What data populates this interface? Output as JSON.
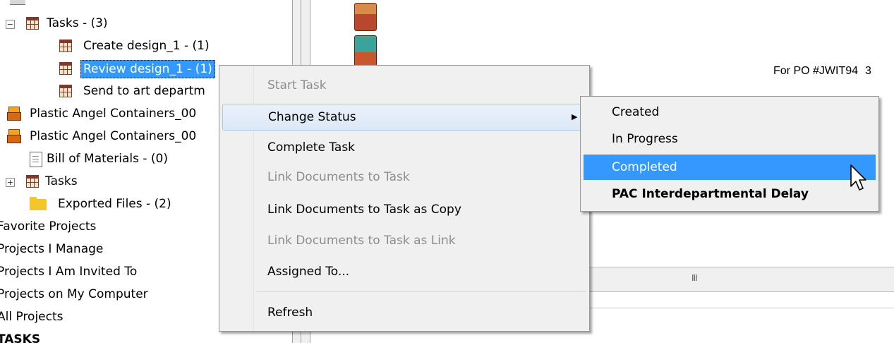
{
  "tree": {
    "items": [
      {
        "label": "Tasks - (3)"
      },
      {
        "label": "Create design_1 - (1)"
      },
      {
        "label": "Review design_1 - (1)"
      },
      {
        "label": "Send to art departm"
      },
      {
        "label": "Plastic Angel Containers_00"
      },
      {
        "label": "Plastic Angel Containers_00"
      },
      {
        "label": "Bill of Materials - (0)"
      },
      {
        "label": "Tasks"
      },
      {
        "label": "Exported Files - (2)"
      },
      {
        "label": "Favorite Projects"
      },
      {
        "label": "Projects I Manage"
      },
      {
        "label": "Projects I Am Invited To"
      },
      {
        "label": "Projects on My Computer"
      },
      {
        "label": "All Projects"
      },
      {
        "label": "TASKS"
      }
    ]
  },
  "right": {
    "po_label": "For PO #JWIT94",
    "po_count": "3",
    "scroll_grip": "III"
  },
  "context_menu": {
    "items": [
      {
        "label": "Start Task"
      },
      {
        "label": "Change Status"
      },
      {
        "label": "Complete Task"
      },
      {
        "label": "Link Documents to Task"
      },
      {
        "label": "Link Documents to Task as Copy"
      },
      {
        "label": "Link Documents to Task as Link"
      },
      {
        "label": "Assigned To..."
      },
      {
        "label": "Refresh"
      }
    ],
    "submenu_arrow": "▶"
  },
  "status_submenu": {
    "items": [
      {
        "label": "Created"
      },
      {
        "label": "In Progress"
      },
      {
        "label": "Completed"
      },
      {
        "label": "PAC Interdepartmental Delay"
      }
    ]
  },
  "colors": {
    "selection": "#3399ff",
    "menu_bg": "#f0f0f0",
    "disabled_text": "#8d8d8d"
  }
}
